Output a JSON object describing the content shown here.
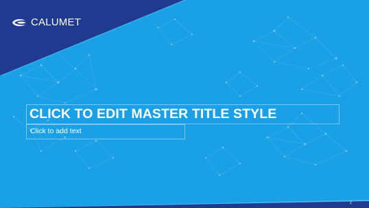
{
  "slide": {
    "brand": {
      "name": "CALUMET",
      "icon": "calumet-logo-icon"
    },
    "title_placeholder": "CLICK TO EDIT MASTER TITLE STYLE",
    "text_placeholder": "Click to add text",
    "slide_number": "2"
  },
  "colors": {
    "background": "#1aa0e6",
    "brand_navy": "#1f3a8f",
    "text": "#ffffff"
  }
}
